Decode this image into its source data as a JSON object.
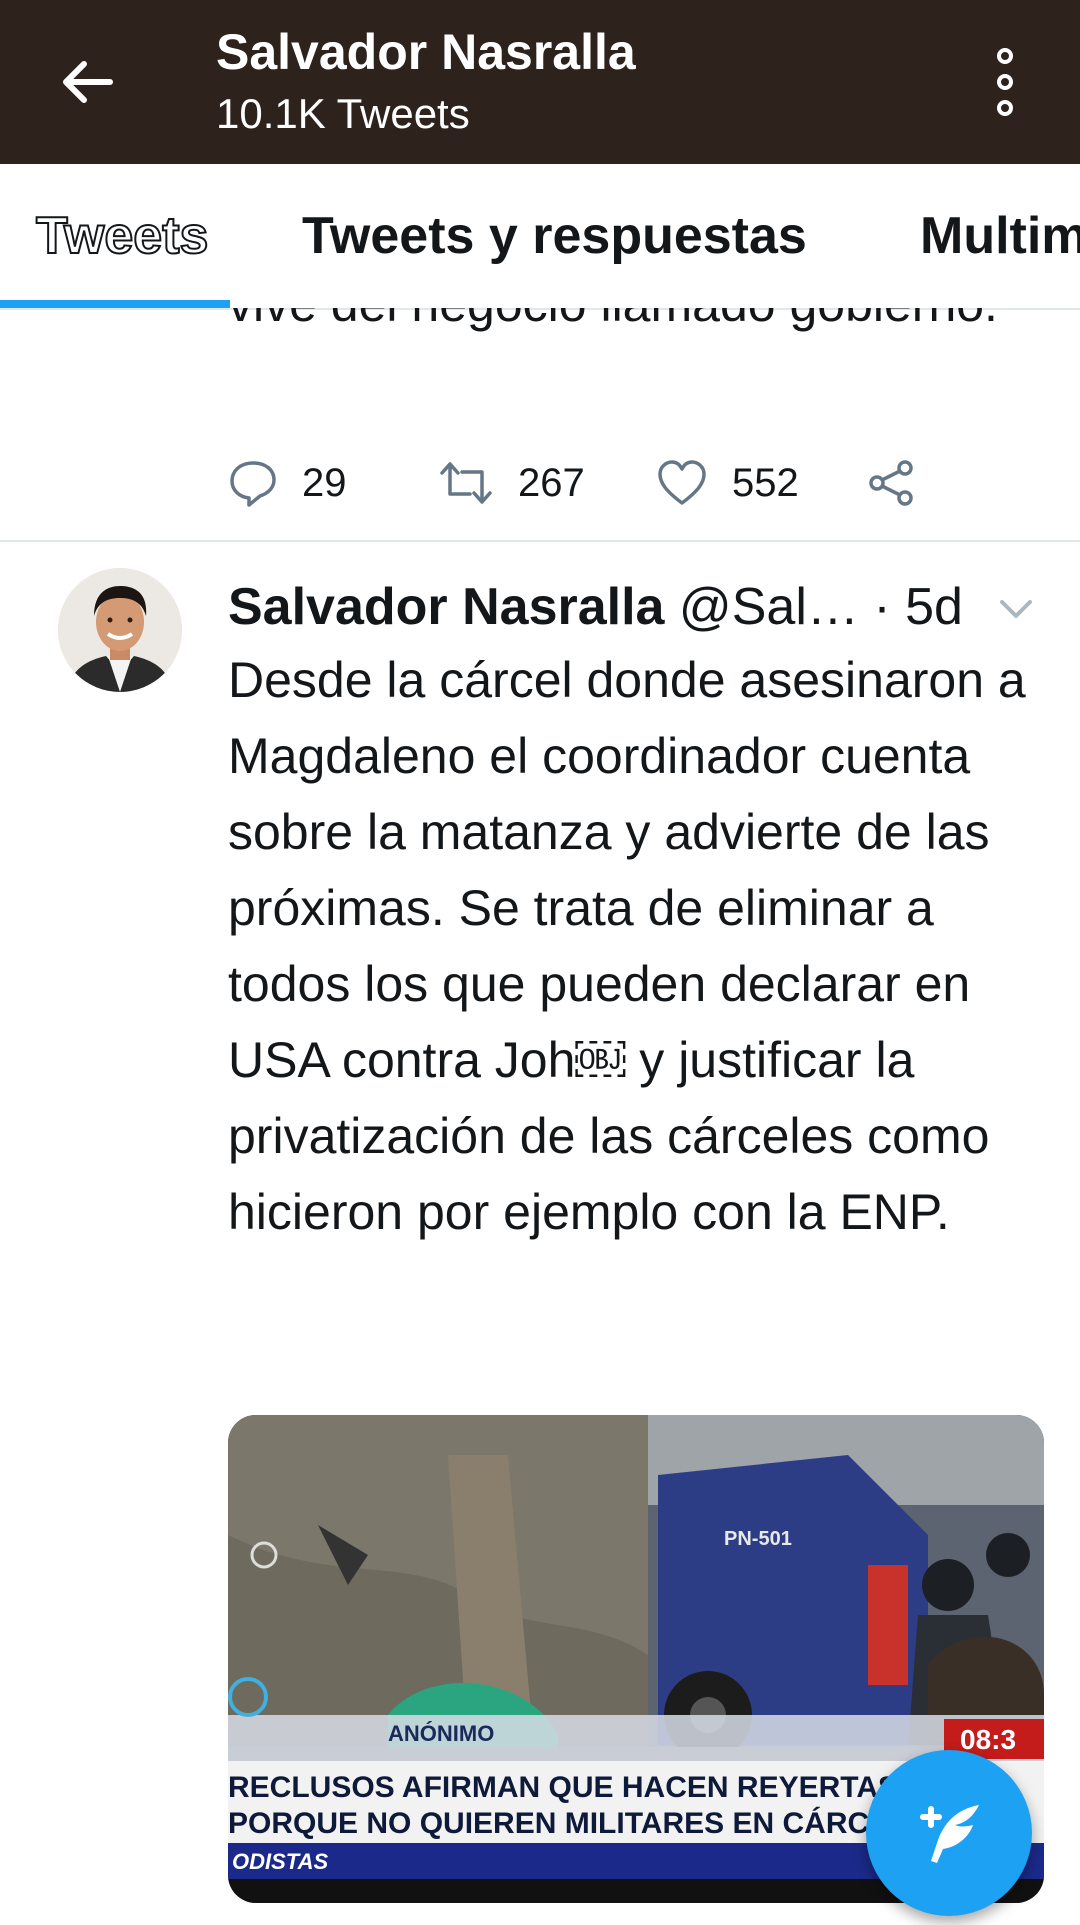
{
  "header": {
    "title": "Salvador Nasralla",
    "subtitle": "10.1K Tweets",
    "back_icon": "arrow-left-icon",
    "menu_icon": "more-vertical-icon",
    "background": "#2e221d"
  },
  "tabs": [
    {
      "label": "Tweets",
      "active": true
    },
    {
      "label": "Tweets y respuestas",
      "active": false
    },
    {
      "label": "Multim",
      "active": false
    }
  ],
  "accent": "#1da1f2",
  "previous_tweet": {
    "text_fragment": "vive del negocio llamado gobierno.",
    "reply_count": "29",
    "retweet_count": "267",
    "like_count": "552"
  },
  "tweet": {
    "author_name": "Salvador Nasralla",
    "handle": "@Sal…",
    "separator": "·",
    "time": "5d",
    "text": "Desde la cárcel donde asesinaron a Magdaleno el coordinador cuenta sobre la matanza y advierte de las próximas. Se trata de eliminar a todos los que pueden declarar en USA contra Joh￼ y justificar la privatización de las cárceles como hicieron por ejemplo con la ENP.",
    "media": {
      "lower_third_tag": "ANÓNIMO",
      "headline_line1": "RECLUSOS AFIRMAN QUE HACEN REYERTAS",
      "headline_line2": "PORQUE NO QUIEREN MILITARES EN CÁRCELES",
      "ticker": "ODISTAS",
      "clock": "08:3",
      "vehicle_text": "PN-501"
    }
  },
  "fab_icon": "compose-tweet-icon"
}
